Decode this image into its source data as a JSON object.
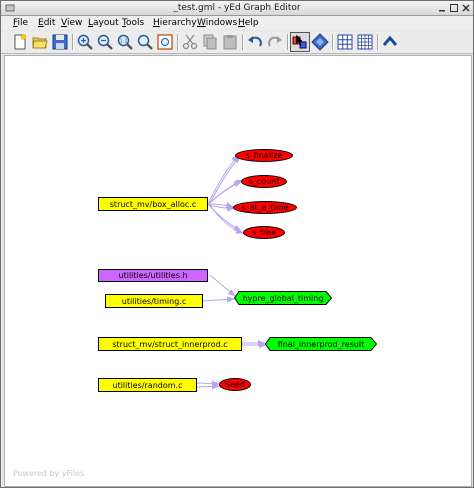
{
  "window": {
    "title": "_test.gml - yEd Graph Editor"
  },
  "menubar": {
    "items": [
      {
        "label": "File",
        "mnemonic": "F",
        "rest": "ile"
      },
      {
        "label": "Edit",
        "mnemonic": "E",
        "rest": "dit"
      },
      {
        "label": "View",
        "mnemonic": "V",
        "rest": "iew"
      },
      {
        "label": "Layout",
        "mnemonic": "L",
        "rest": "ayout"
      },
      {
        "label": "Tools",
        "mnemonic": "T",
        "rest": "ools"
      },
      {
        "label": "Hierarchy",
        "mnemonic": "H",
        "rest": "ierarchy"
      },
      {
        "label": "Windows",
        "mnemonic": "W",
        "rest": "indows"
      },
      {
        "label": "Help",
        "mnemonic": "H",
        "rest": "elp"
      }
    ]
  },
  "toolbar": {
    "icons": [
      "new-document-icon",
      "open-folder-icon",
      "save-icon",
      "zoom-in-icon",
      "zoom-out-icon",
      "zoom-fit-icon",
      "zoom-area-icon",
      "fit-content-icon",
      "cut-icon",
      "copy-icon",
      "paste-icon",
      "undo-icon",
      "redo-icon",
      "edit-mode-icon",
      "layout-icon",
      "grid-icon",
      "snap-grid-icon",
      "up-arrow-icon"
    ]
  },
  "graph": {
    "nodes": {
      "box_alloc": "struct_mv/box_alloc.c",
      "s_finalize": "s_finalize",
      "s_count": "s_count",
      "s_at_a_time": "s_at_a_time",
      "s_free": "s_free",
      "utilities_h": "utilities/utilities.h",
      "timing_c": "utilities/timing.c",
      "hypre_global_timing": "hypre_global_timing",
      "struct_innerprod": "struct_mv/struct_innerprod.c",
      "final_innerprod_result": "final_innerprod_result",
      "random_c": "utilities/random.c",
      "seed": "Seed"
    },
    "colors": {
      "file_node": "#ffff00",
      "header_node": "#cc66ff",
      "variable_node": "#ff0000",
      "output_node": "#00ff00",
      "edge": "#b9a3f0"
    }
  },
  "watermark": "Powered by yFiles"
}
